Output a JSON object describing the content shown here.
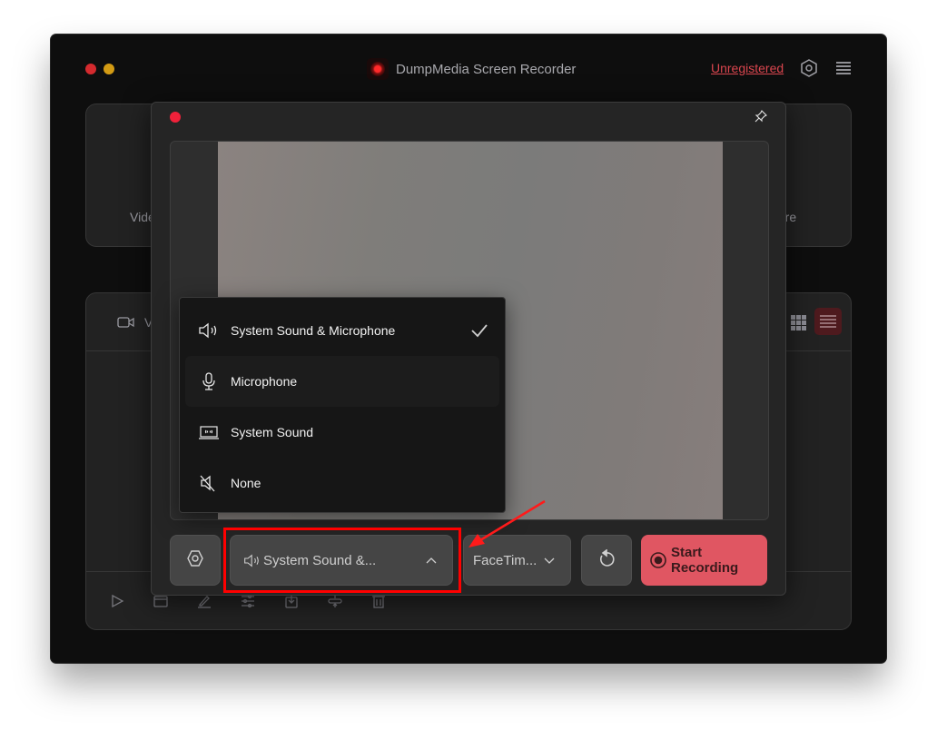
{
  "app": {
    "title": "DumpMedia Screen Recorder",
    "registration_link": "Unregistered",
    "logo_icon": "record-logo-icon",
    "header_icons": [
      "settings-hexagon-icon",
      "hamburger-menu-icon"
    ]
  },
  "mode_cards": [
    {
      "label": "Video Recorder",
      "visible_text": "Vide"
    },
    {
      "label": "Screen Capture",
      "visible_text": "ture"
    }
  ],
  "list_panel": {
    "tab_label_visible": "V",
    "tab_icon": "video-camera-icon",
    "view_icons": [
      "grid-view-icon",
      "list-view-icon"
    ],
    "footer_icons": [
      "play-icon",
      "folder-icon",
      "edit-icon",
      "adjust-sliders-icon",
      "import-icon",
      "merge-icon",
      "trash-icon"
    ]
  },
  "recorder": {
    "pin_icon": "pin-icon",
    "audio_menu": {
      "items": [
        {
          "label": "System Sound & Microphone",
          "icon": "speaker-icon",
          "selected": true
        },
        {
          "label": "Microphone",
          "icon": "microphone-icon",
          "selected": false
        },
        {
          "label": "System Sound",
          "icon": "laptop-sound-icon",
          "selected": false
        },
        {
          "label": "None",
          "icon": "muted-speaker-icon",
          "selected": false
        }
      ]
    },
    "controls": {
      "audio_select_value": "System Sound &...",
      "camera_select_value": "FaceTim...",
      "start_label": "Start Recording"
    }
  },
  "colors": {
    "accent_red": "#e05662",
    "unregistered_red": "#d9454e",
    "annotation_red": "#ff0000",
    "window_bg": "#0e0e0e",
    "panel_bg": "#222222"
  }
}
